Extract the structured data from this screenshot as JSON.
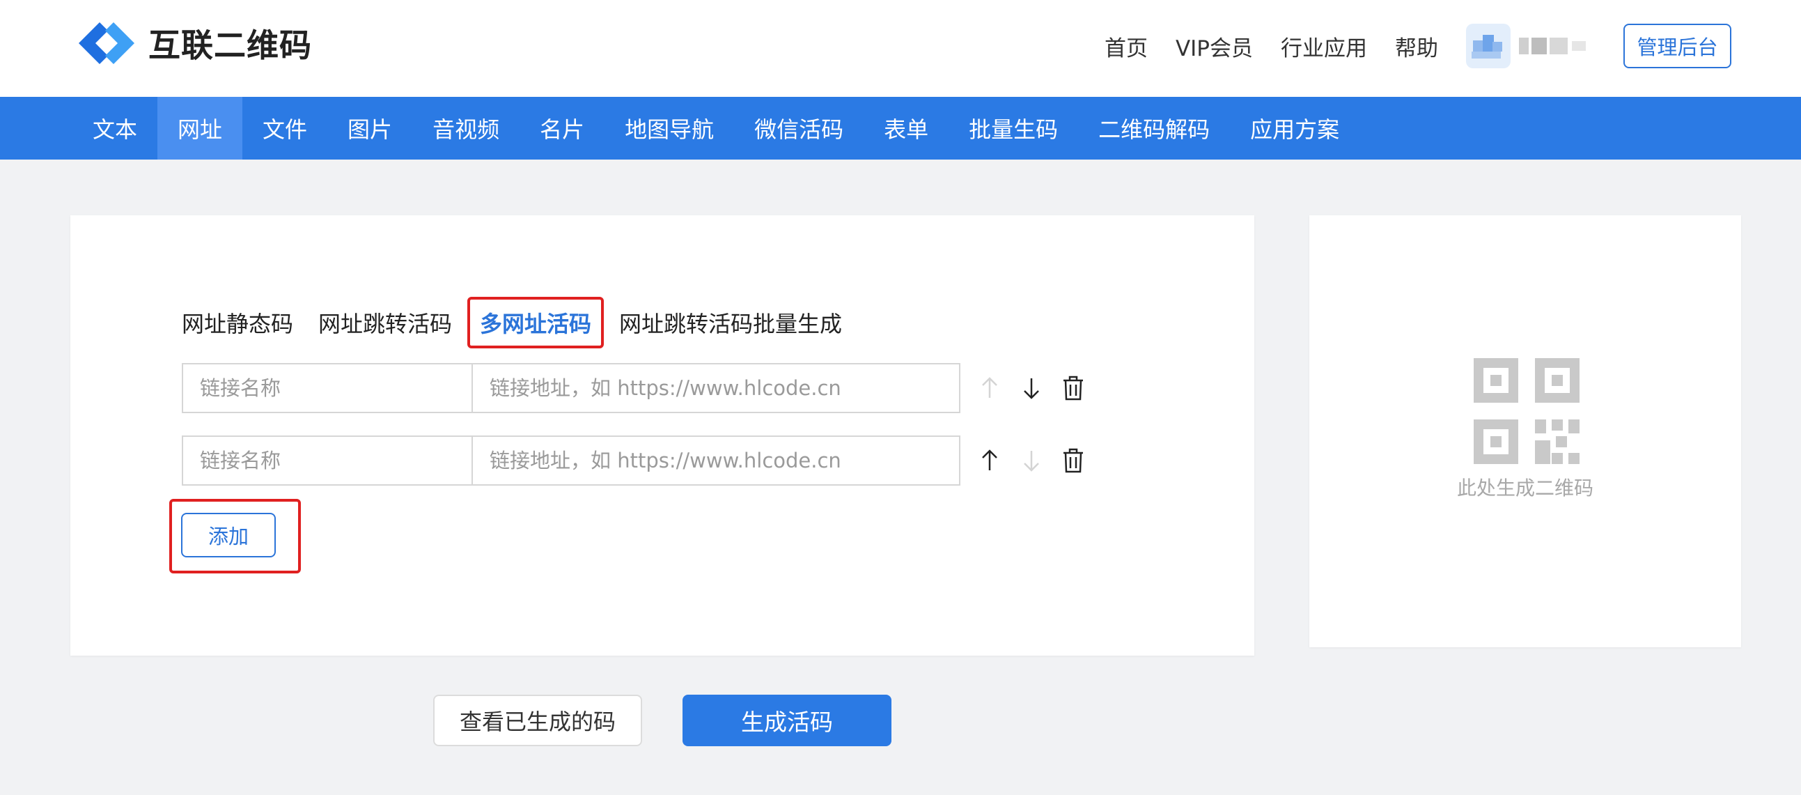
{
  "brand": {
    "name": "互联二维码",
    "colors": {
      "primary": "#2b7ae4",
      "highlight": "#e02020"
    }
  },
  "topnav": {
    "items": [
      "首页",
      "VIP会员",
      "行业应用",
      "帮助"
    ],
    "admin_label": "管理后台"
  },
  "mainnav": {
    "items": [
      "文本",
      "网址",
      "文件",
      "图片",
      "音视频",
      "名片",
      "地图导航",
      "微信活码",
      "表单",
      "批量生码",
      "二维码解码",
      "应用方案"
    ],
    "active_index": 1
  },
  "subtabs": {
    "items": [
      "网址静态码",
      "网址跳转活码",
      "多网址活码",
      "网址跳转活码批量生成"
    ],
    "active_index": 2
  },
  "links": [
    {
      "name_placeholder": "链接名称",
      "url_placeholder": "链接地址，如 https://www.hlcode.cn",
      "up_enabled": false,
      "down_enabled": true
    },
    {
      "name_placeholder": "链接名称",
      "url_placeholder": "链接地址，如 https://www.hlcode.cn",
      "up_enabled": true,
      "down_enabled": false
    }
  ],
  "add_label": "添加",
  "preview": {
    "text": "此处生成二维码",
    "icon": "qr-code-icon"
  },
  "actions": {
    "view_label": "查看已生成的码",
    "generate_label": "生成活码"
  }
}
